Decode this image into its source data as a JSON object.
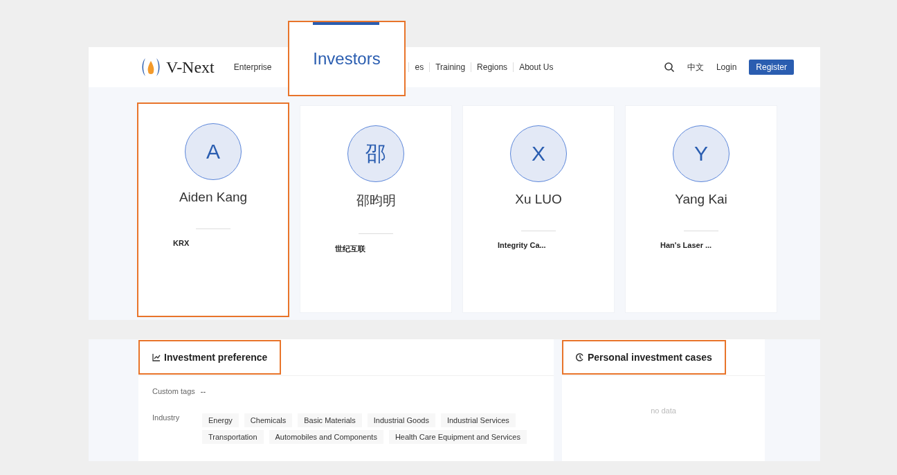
{
  "header": {
    "logo": "V-Next",
    "nav": [
      {
        "label": "Enterprise",
        "selected": false
      },
      {
        "label": "es",
        "selected": false
      },
      {
        "label": "Training",
        "selected": false
      },
      {
        "label": "Regions",
        "selected": false
      },
      {
        "label": "About Us",
        "selected": false
      }
    ],
    "language": "中文",
    "login": "Login",
    "register": "Register"
  },
  "callout": {
    "label": "Investors",
    "selected": true
  },
  "investors": [
    {
      "initial": "A",
      "name": "Aiden Kang",
      "company": "KRX",
      "highlighted": true
    },
    {
      "initial": "邵",
      "name": "邵昀明",
      "company": "世纪互联",
      "highlighted": false
    },
    {
      "initial": "X",
      "name": "Xu LUO",
      "company": "Integrity Ca...",
      "highlighted": false
    },
    {
      "initial": "Y",
      "name": "Yang Kai",
      "company": "Han's Laser ...",
      "highlighted": false
    }
  ],
  "preference": {
    "title": "Investment preference",
    "highlighted": true,
    "custom_tags_label": "Custom tags",
    "custom_tags_value": "--",
    "industry_label": "Industry",
    "industries": [
      "Energy",
      "Chemicals",
      "Basic Materials",
      "Industrial Goods",
      "Industrial Services",
      "Transportation",
      "Automobiles and Components",
      "Health Care Equipment and Services"
    ]
  },
  "cases": {
    "title": "Personal investment cases",
    "highlighted": true,
    "empty": "no data"
  }
}
